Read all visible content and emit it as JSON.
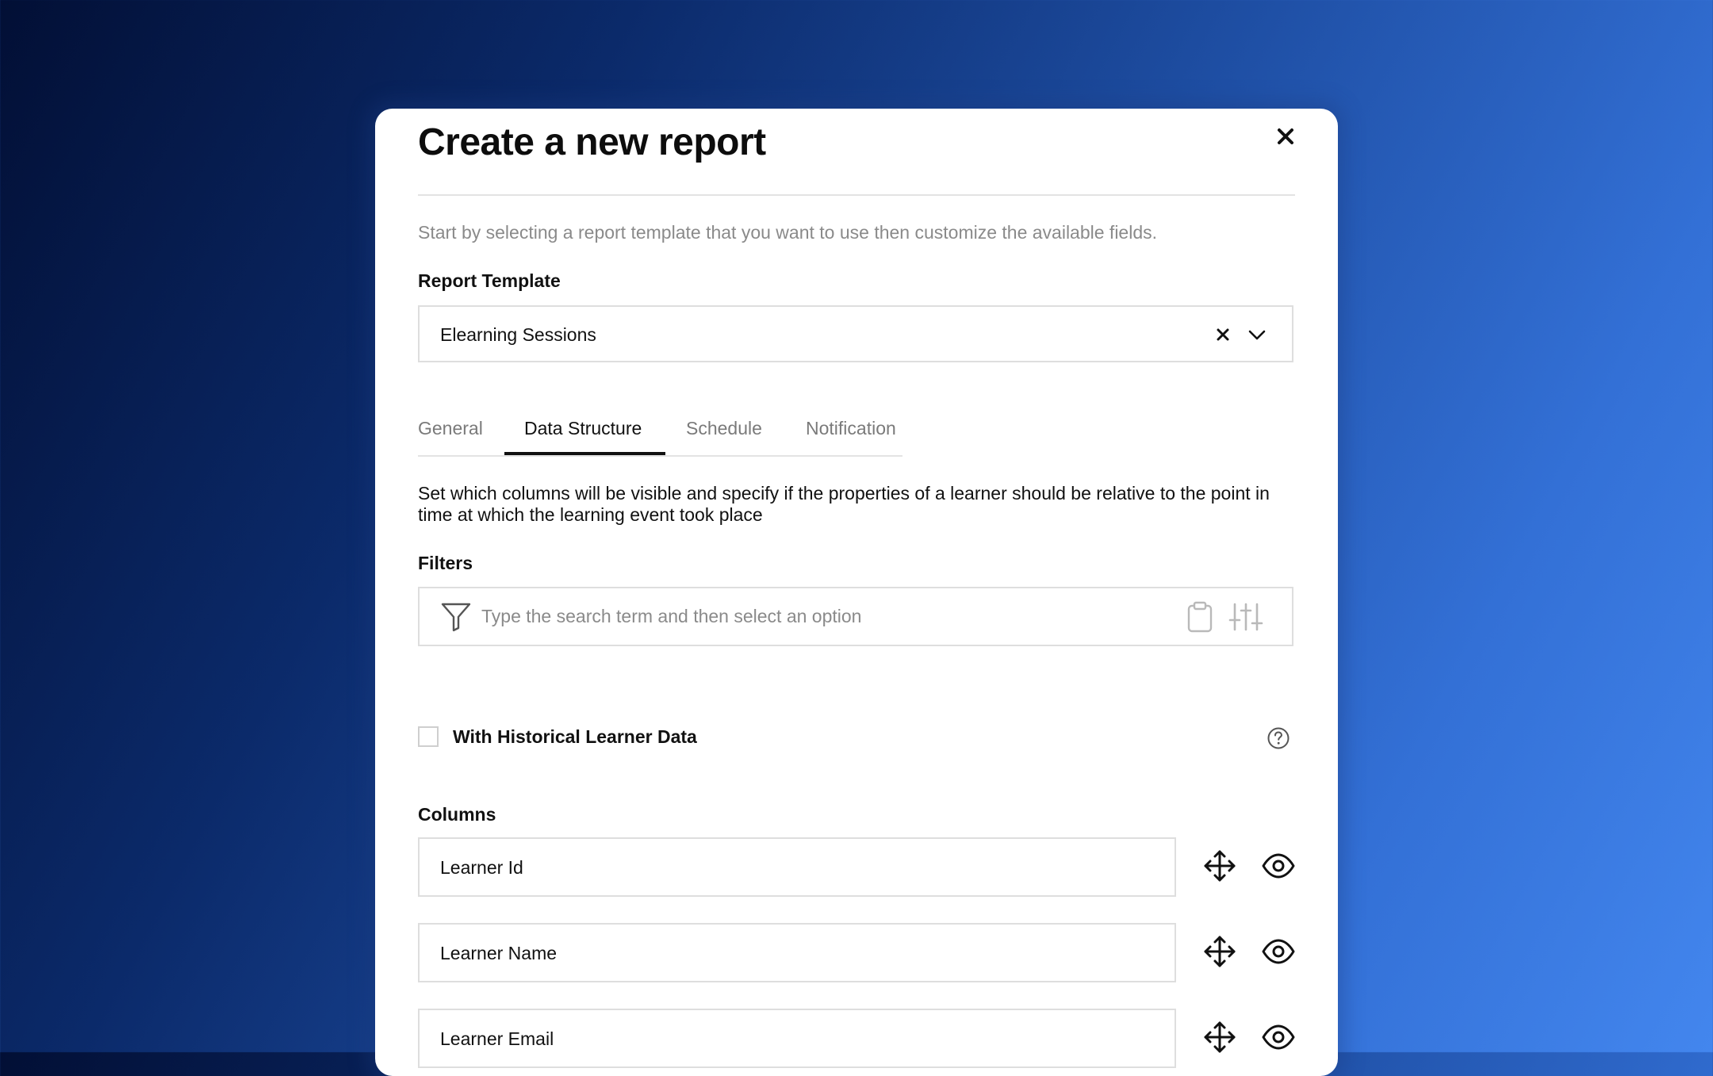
{
  "dialog": {
    "title": "Create a new report",
    "subtitle": "Start by selecting a report template that you want to use then customize the available fields."
  },
  "template": {
    "label": "Report Template",
    "value": "Elearning Sessions"
  },
  "tabs": [
    {
      "label": "General",
      "active": false
    },
    {
      "label": "Data Structure",
      "active": true
    },
    {
      "label": "Schedule",
      "active": false
    },
    {
      "label": "Notification",
      "active": false
    }
  ],
  "data_structure": {
    "description": "Set which columns will be visible and specify if the properties of a learner should be relative to the point in time at which the learning event took place",
    "filters_label": "Filters",
    "filter_placeholder": "Type the search term and then select an option",
    "historical_label": "With Historical Learner Data",
    "historical_checked": false,
    "columns_label": "Columns",
    "columns": [
      {
        "label": "Learner Id"
      },
      {
        "label": "Learner Name"
      },
      {
        "label": "Learner Email"
      }
    ]
  },
  "icons": {
    "close": "close-icon",
    "clear": "clear-icon",
    "dropdown": "chevron-down-icon",
    "filter": "funnel-icon",
    "paste": "clipboard-icon",
    "advanced": "sliders-icon",
    "help": "question-circle-icon",
    "reorder": "move-icon",
    "visibility": "eye-icon"
  },
  "colors": {
    "background_gradient": [
      "#020f35",
      "#4386ee"
    ],
    "text": "#111111",
    "muted": "#8a8a8a",
    "border": "#dedede"
  }
}
